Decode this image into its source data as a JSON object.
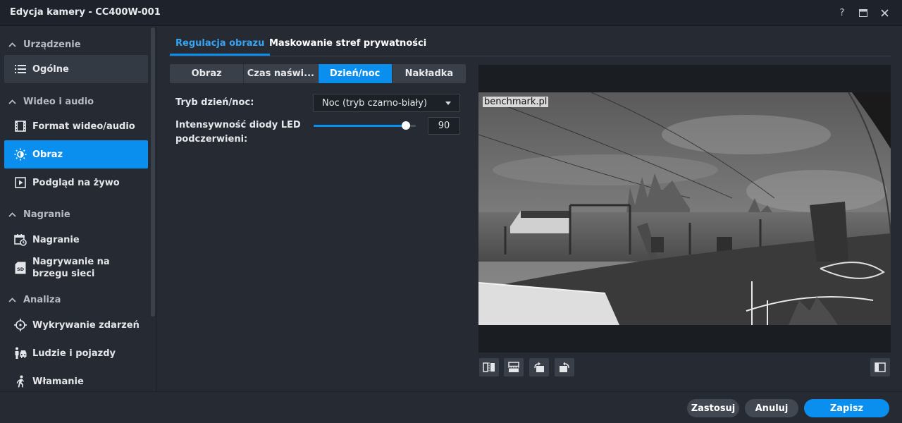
{
  "window": {
    "title": "Edycja kamery - CC400W-001",
    "help_label": "?"
  },
  "sidebar": {
    "groups": [
      {
        "label": "Urządzenie"
      },
      {
        "label": "Wideo i audio"
      },
      {
        "label": "Nagranie"
      },
      {
        "label": "Analiza"
      }
    ],
    "items": [
      {
        "label": "Ogólne",
        "icon": "list-icon"
      },
      {
        "label": "Format wideo/audio",
        "icon": "film-icon"
      },
      {
        "label": "Obraz",
        "icon": "brightness-icon",
        "active": true
      },
      {
        "label": "Podgląd na żywo",
        "icon": "play-icon"
      },
      {
        "label": "Nagranie",
        "icon": "calendar-clock-icon"
      },
      {
        "label": "Nagrywanie na brzegu sieci",
        "icon": "sd-card-icon",
        "icon_text": "SD"
      },
      {
        "label": "Wykrywanie zdarzeń",
        "icon": "crosshair-icon"
      },
      {
        "label": "Ludzie i pojazdy",
        "icon": "person-vehicle-icon"
      },
      {
        "label": "Włamanie",
        "icon": "running-person-icon"
      }
    ]
  },
  "tabs": {
    "main": [
      {
        "label": "Regulacja obrazu",
        "active": true
      },
      {
        "label": "Maskowanie stref prywatności",
        "active": false
      }
    ],
    "sub": [
      {
        "label": "Obraz"
      },
      {
        "label": "Czas naświ..."
      },
      {
        "label": "Dzień/noc",
        "active": true
      },
      {
        "label": "Nakładka"
      }
    ]
  },
  "form": {
    "daynight_label": "Tryb dzień/noc:",
    "daynight_value": "Noc (tryb czarno-biały)",
    "led_label_line1": "Intensywność diody LED",
    "led_label_line2": "podczerwieni:",
    "led_value": "90",
    "led_max": 100
  },
  "preview": {
    "watermark": "benchmark.pl"
  },
  "footer": {
    "apply_label": "Zastosuj",
    "cancel_label": "Anuluj",
    "save_label": "Zapisz"
  },
  "colors": {
    "accent": "#0a8fef",
    "background": "#252a33",
    "titlebar": "#1e232b"
  }
}
